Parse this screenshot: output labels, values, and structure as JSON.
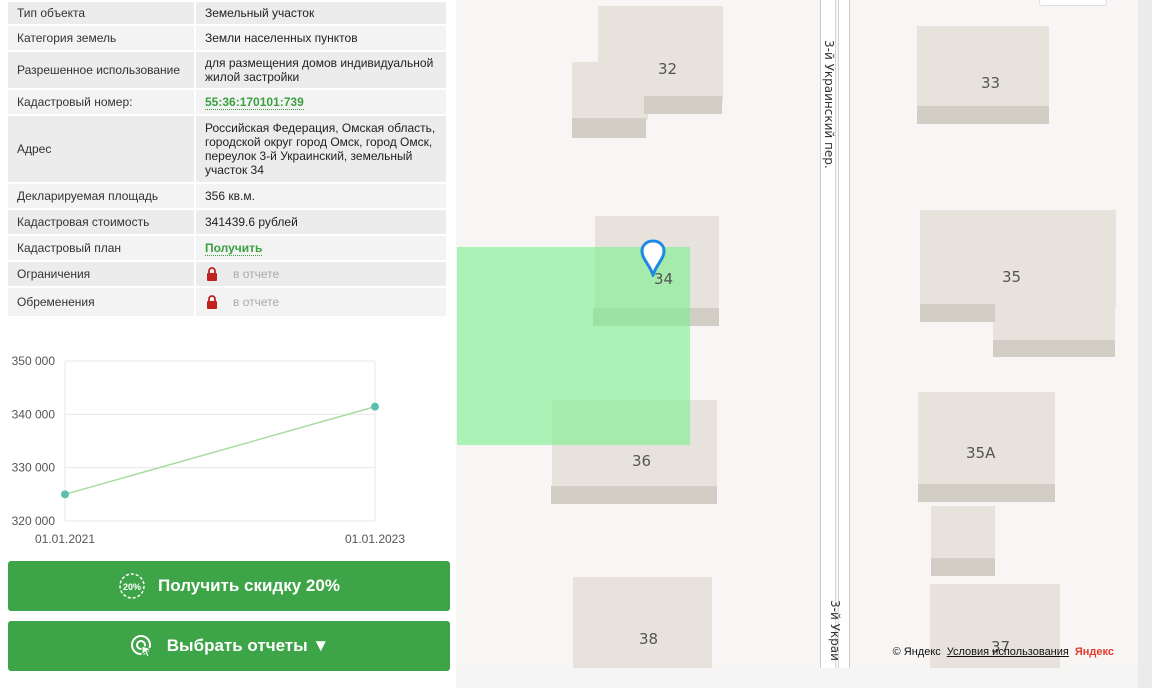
{
  "properties": [
    {
      "key": "Тип объекта",
      "value": "Земельный участок",
      "type": "text"
    },
    {
      "key": "Категория земель",
      "value": "Земли населенных пунктов",
      "type": "text"
    },
    {
      "key": "Разрешенное использование",
      "value": "для размещения домов индивидуальной жилой застройки",
      "type": "text"
    },
    {
      "key": "Кадастровый номер:",
      "value": "55:36:170101:739",
      "type": "link"
    },
    {
      "key": "Адрес",
      "value": "Российская Федерация, Омская область, городской округ город Омск, город Омск, переулок 3-й Украинский, земельный участок 34",
      "type": "text"
    },
    {
      "key": "Декларируемая площадь",
      "value": "356 кв.м.",
      "type": "text"
    },
    {
      "key": "Кадастровая стоимость",
      "value": "341439.6 рублей",
      "type": "text"
    },
    {
      "key": "Кадастровый план",
      "value": "Получить",
      "type": "link"
    },
    {
      "key": "Ограничения",
      "value": "в отчете",
      "type": "locked"
    },
    {
      "key": "Обременения",
      "value": "в отчете",
      "type": "locked"
    }
  ],
  "chart_data": {
    "type": "line",
    "x": [
      "01.01.2021",
      "01.01.2023"
    ],
    "y": [
      325000,
      341439.6
    ],
    "yticks": [
      "350 000",
      "340 000",
      "330 000",
      "320 000"
    ],
    "ylim": [
      320000,
      350000
    ],
    "grid": true,
    "color": "#5bbfb0",
    "line_color": "#a8dca0"
  },
  "buttons": {
    "discount_label": "Получить скидку 20%",
    "discount_badge": "20%",
    "reports_label": "Выбрать отчеты ▼"
  },
  "map": {
    "street_top": "3-й Украинский пер.",
    "street_bottom": "3-й Украи",
    "buildings": [
      "32",
      "33",
      "34",
      "35",
      "35А",
      "36",
      "37",
      "38"
    ],
    "attribution": "© Яндекс",
    "terms": "Условия использования",
    "brand": "Яндекс"
  },
  "colors": {
    "accent": "#3da548",
    "plot": "#7df08c",
    "link": "#3aa040"
  }
}
